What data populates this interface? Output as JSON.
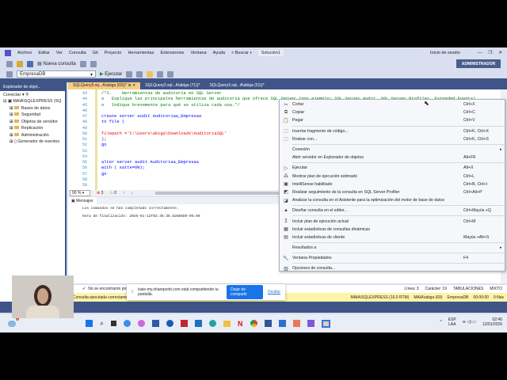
{
  "menu": [
    "Archivo",
    "Editar",
    "Ver",
    "Consulta",
    "Git",
    "Proyecto",
    "Herramientas",
    "Extensiones",
    "Ventana",
    "Ayuda"
  ],
  "search": "Buscar",
  "solution": "Solución1",
  "signin": "Inicio de sesión",
  "admin": "ADMINISTRADOR",
  "toolbar": {
    "new_query": "Nueva consulta",
    "database": "EmpresaDB",
    "execute": "Ejecutar"
  },
  "object_explorer": {
    "title": "Explorador de objet...",
    "connect": "Conectar",
    "server": "MAIA\\SQLEXPRESS (SQ",
    "items": [
      "Bases de datos",
      "Seguridad",
      "Objetos de servidor",
      "Replicación",
      "Administración",
      "Generador de eventos"
    ]
  },
  "tabs": [
    "SQLQuery5.sq...A\\abiga (69))*",
    "SQLQuery2.sql...A\\abiga (71))*",
    "SQLQuery3.sql...A\\abiga (51))*"
  ],
  "code": {
    "line_numbers": [
      "43",
      "44",
      "45",
      "46",
      "47",
      "48",
      "49",
      "50",
      "51",
      "52",
      "53",
      "54",
      "55",
      "56",
      "57",
      "58",
      "59"
    ],
    "lines": [
      {
        "t": "/*2.    Herramientas de auditoría en SQL Server",
        "c": "cm"
      },
      {
        "t": "o   Explique las principales herramientas de auditoría que ofrece SQL Server (por ejemplo: SQL Server Audit, SQL Server Profiler, Extended Events)",
        "c": "cm"
      },
      {
        "t": "o   Indique brevemente para qué se utiliza cada una.*/",
        "c": "cm"
      },
      {
        "t": "",
        "c": ""
      },
      {
        "t": "create server audit Auditoriaa_Empresaa",
        "c": "kw"
      },
      {
        "t": "to file (",
        "c": "kw"
      },
      {
        "t": "",
        "c": ""
      },
      {
        "t": "filepath ='C:\\Users\\abiga\\Downloads\\AuditoriaSQL'",
        "c": "str"
      },
      {
        "t": ");",
        "c": ""
      },
      {
        "t": "go",
        "c": "kw"
      },
      {
        "t": "",
        "c": ""
      },
      {
        "t": "",
        "c": ""
      },
      {
        "t": "alter server audit Auditoriaa_Empresaa",
        "c": "kw"
      },
      {
        "t": "with ( satte=ON);",
        "c": "kw"
      },
      {
        "t": "go",
        "c": "kw"
      },
      {
        "t": "",
        "c": ""
      },
      {
        "t": "",
        "c": ""
      }
    ]
  },
  "editor_status": {
    "zoom": "90 %",
    "errors": "3",
    "warnings": "0"
  },
  "messages": {
    "tab": "Mensajes",
    "line1": "Los comandos se han completado correctamente.",
    "line2": "Hora de finalización: 2026-01-12T02:45:36.8288589-05:00"
  },
  "status": {
    "problems": "No se encontraron problemas",
    "line": "Línea: 3",
    "char": "Carácter: 19",
    "tabs": "TABULACIONES",
    "mixed": "MIXTO",
    "query_ok": "Consulta ejecutada correctamente.",
    "server": "MAIA\\SQLEXPRESS (16.0 RTM)",
    "user": "MAIA\\abiga (69)",
    "db": "EmpresaDB",
    "time": "00:00:00",
    "rows": "0 filas"
  },
  "share_banner": {
    "text": "issie-my.sharepoint.com está compartiendo tu pantalla.",
    "stop": "Dejar de compartir",
    "hide": "Ocultar"
  },
  "context_menu": [
    {
      "icon": "✂",
      "label": "Cortar",
      "shortcut": "Ctrl+X"
    },
    {
      "icon": "⧉",
      "label": "Copiar",
      "shortcut": "Ctrl+C"
    },
    {
      "icon": "📋",
      "label": "Pegar",
      "shortcut": "Ctrl+V",
      "sep": true
    },
    {
      "icon": "⬚",
      "label": "Insertar fragmento de código...",
      "shortcut": "Ctrl+K, Ctrl+X"
    },
    {
      "icon": "⬚",
      "label": "Rodear con...",
      "shortcut": "Ctrl+K, Ctrl+S",
      "sep": true
    },
    {
      "icon": "",
      "label": "Conexión",
      "shortcut": "",
      "sub": true
    },
    {
      "icon": "",
      "label": "Abrir servidor en Explorador de objetos",
      "shortcut": "Alt+F8",
      "sep": true
    },
    {
      "icon": "▷",
      "label": "Ejecutar",
      "shortcut": "Alt+X"
    },
    {
      "icon": "⁂",
      "label": "Mostrar plan de ejecución estimado",
      "shortcut": "Ctrl+L"
    },
    {
      "icon": "▣",
      "label": "IntelliSense habilitado",
      "shortcut": "Ctrl+B, Ctrl+I"
    },
    {
      "icon": "◩",
      "label": "Realizar seguimiento de la consulta en SQL Server Profiler",
      "shortcut": "Ctrl+Alt+P"
    },
    {
      "icon": "◪",
      "label": "Analizar la consulta en el Asistente para la optimización del motor de base de datos",
      "shortcut": "",
      "sep": true
    },
    {
      "icon": "▲",
      "label": "Diseñar consulta en el editor...",
      "shortcut": "Ctrl+Mayús.+Q",
      "sep": true
    },
    {
      "icon": "⁑",
      "label": "Incluir plan de ejecución actual",
      "shortcut": "Ctrl+M"
    },
    {
      "icon": "▦",
      "label": "Incluir estadísticas de consultas dinámicas",
      "shortcut": ""
    },
    {
      "icon": "▤",
      "label": "Incluir estadísticas de cliente",
      "shortcut": "Mayús.+Alt+S",
      "sep": true
    },
    {
      "icon": "",
      "label": "Resultados a",
      "shortcut": "",
      "sub": true,
      "sep": true
    },
    {
      "icon": "🔧",
      "label": "Ventana Propiedades",
      "shortcut": "F4",
      "sep": true
    },
    {
      "icon": "▥",
      "label": "Opciones de consulta...",
      "shortcut": ""
    }
  ],
  "tray": {
    "lang": "ESP",
    "region": "LAA",
    "time": "02:46",
    "date": "12/01/2026",
    "badge": "2"
  }
}
